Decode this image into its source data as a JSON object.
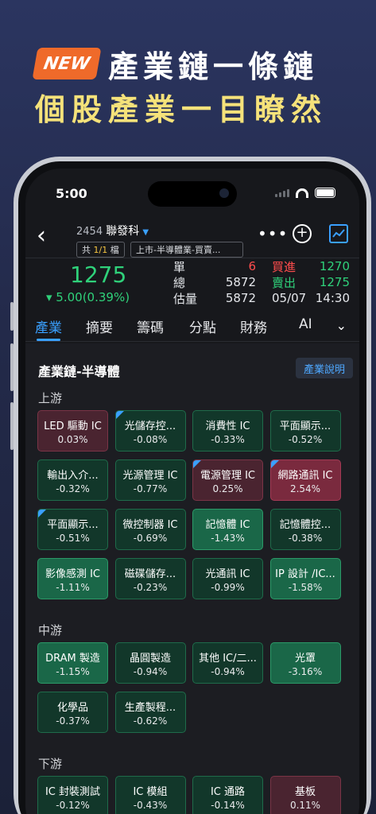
{
  "promo": {
    "badge": "NEW",
    "headline1": "產業鏈一條鏈",
    "headline2": "個股產業一目瞭然"
  },
  "status": {
    "time": "5:00"
  },
  "stock": {
    "code": "2454",
    "name": "聯發科",
    "count_prefix": "共",
    "count_value": "1/1",
    "count_suffix": "檔",
    "category": "上市-半導體業-買賣..."
  },
  "quote": {
    "price": "1275",
    "change": "▾ 5.00(0.39%)",
    "rows": [
      {
        "l1": "單",
        "v1": "6",
        "l2": "買進",
        "v2": "1270"
      },
      {
        "l1": "總",
        "v1": "5872",
        "l2": "賣出",
        "v2": "1275"
      },
      {
        "l1": "估量",
        "v1": "5872",
        "l2": "05/07",
        "v2": "14:30"
      }
    ]
  },
  "tabs": [
    "產業",
    "摘要",
    "籌碼",
    "分點",
    "財務",
    "AI"
  ],
  "section": {
    "title": "產業鏈-半導體",
    "explain": "產業說明"
  },
  "groups": {
    "upstream": "上游",
    "midstream": "中游",
    "downstream": "下游"
  },
  "chips": {
    "up": [
      {
        "name": "LED 驅動 IC",
        "pct": "0.03%",
        "style": "red",
        "corner": false
      },
      {
        "name": "光儲存控...",
        "pct": "-0.08%",
        "style": "green",
        "corner": true
      },
      {
        "name": "消費性 IC",
        "pct": "-0.33%",
        "style": "green",
        "corner": false
      },
      {
        "name": "平面顯示...",
        "pct": "-0.52%",
        "style": "green",
        "corner": false
      },
      {
        "name": "輸出入介...",
        "pct": "-0.32%",
        "style": "green",
        "corner": false
      },
      {
        "name": "光源管理 IC",
        "pct": "-0.77%",
        "style": "green",
        "corner": false
      },
      {
        "name": "電源管理 IC",
        "pct": "0.25%",
        "style": "red",
        "corner": true
      },
      {
        "name": "網路通訊 IC",
        "pct": "2.54%",
        "style": "redDark",
        "corner": true
      },
      {
        "name": "平面顯示...",
        "pct": "-0.51%",
        "style": "green",
        "corner": true
      },
      {
        "name": "微控制器 IC",
        "pct": "-0.69%",
        "style": "green",
        "corner": false
      },
      {
        "name": "記憶體 IC",
        "pct": "-1.43%",
        "style": "greenDark",
        "corner": false
      },
      {
        "name": "記憶體控...",
        "pct": "-0.38%",
        "style": "green",
        "corner": false
      },
      {
        "name": "影像感測 IC",
        "pct": "-1.11%",
        "style": "greenDark",
        "corner": false
      },
      {
        "name": "磁碟儲存...",
        "pct": "-0.23%",
        "style": "green",
        "corner": false
      },
      {
        "name": "光通訊 IC",
        "pct": "-0.99%",
        "style": "green",
        "corner": false
      },
      {
        "name": "IP 設計 /IC...",
        "pct": "-1.58%",
        "style": "greenDark",
        "corner": false
      }
    ],
    "mid": [
      {
        "name": "DRAM 製造",
        "pct": "-1.15%",
        "style": "greenDark",
        "corner": false
      },
      {
        "name": "晶圓製造",
        "pct": "-0.94%",
        "style": "green",
        "corner": false
      },
      {
        "name": "其他 IC/二...",
        "pct": "-0.94%",
        "style": "green",
        "corner": false
      },
      {
        "name": "光罩",
        "pct": "-3.16%",
        "style": "greenDark",
        "corner": false
      },
      {
        "name": "化學品",
        "pct": "-0.37%",
        "style": "green",
        "corner": false
      },
      {
        "name": "生產製程...",
        "pct": "-0.62%",
        "style": "green",
        "corner": false
      }
    ],
    "down": [
      {
        "name": "IC 封裝測試",
        "pct": "-0.12%",
        "style": "green",
        "corner": false
      },
      {
        "name": "IC 模組",
        "pct": "-0.43%",
        "style": "green",
        "corner": false
      },
      {
        "name": "IC 通路",
        "pct": "-0.14%",
        "style": "green",
        "corner": false
      },
      {
        "name": "基板",
        "pct": "0.11%",
        "style": "red",
        "corner": false
      }
    ]
  }
}
